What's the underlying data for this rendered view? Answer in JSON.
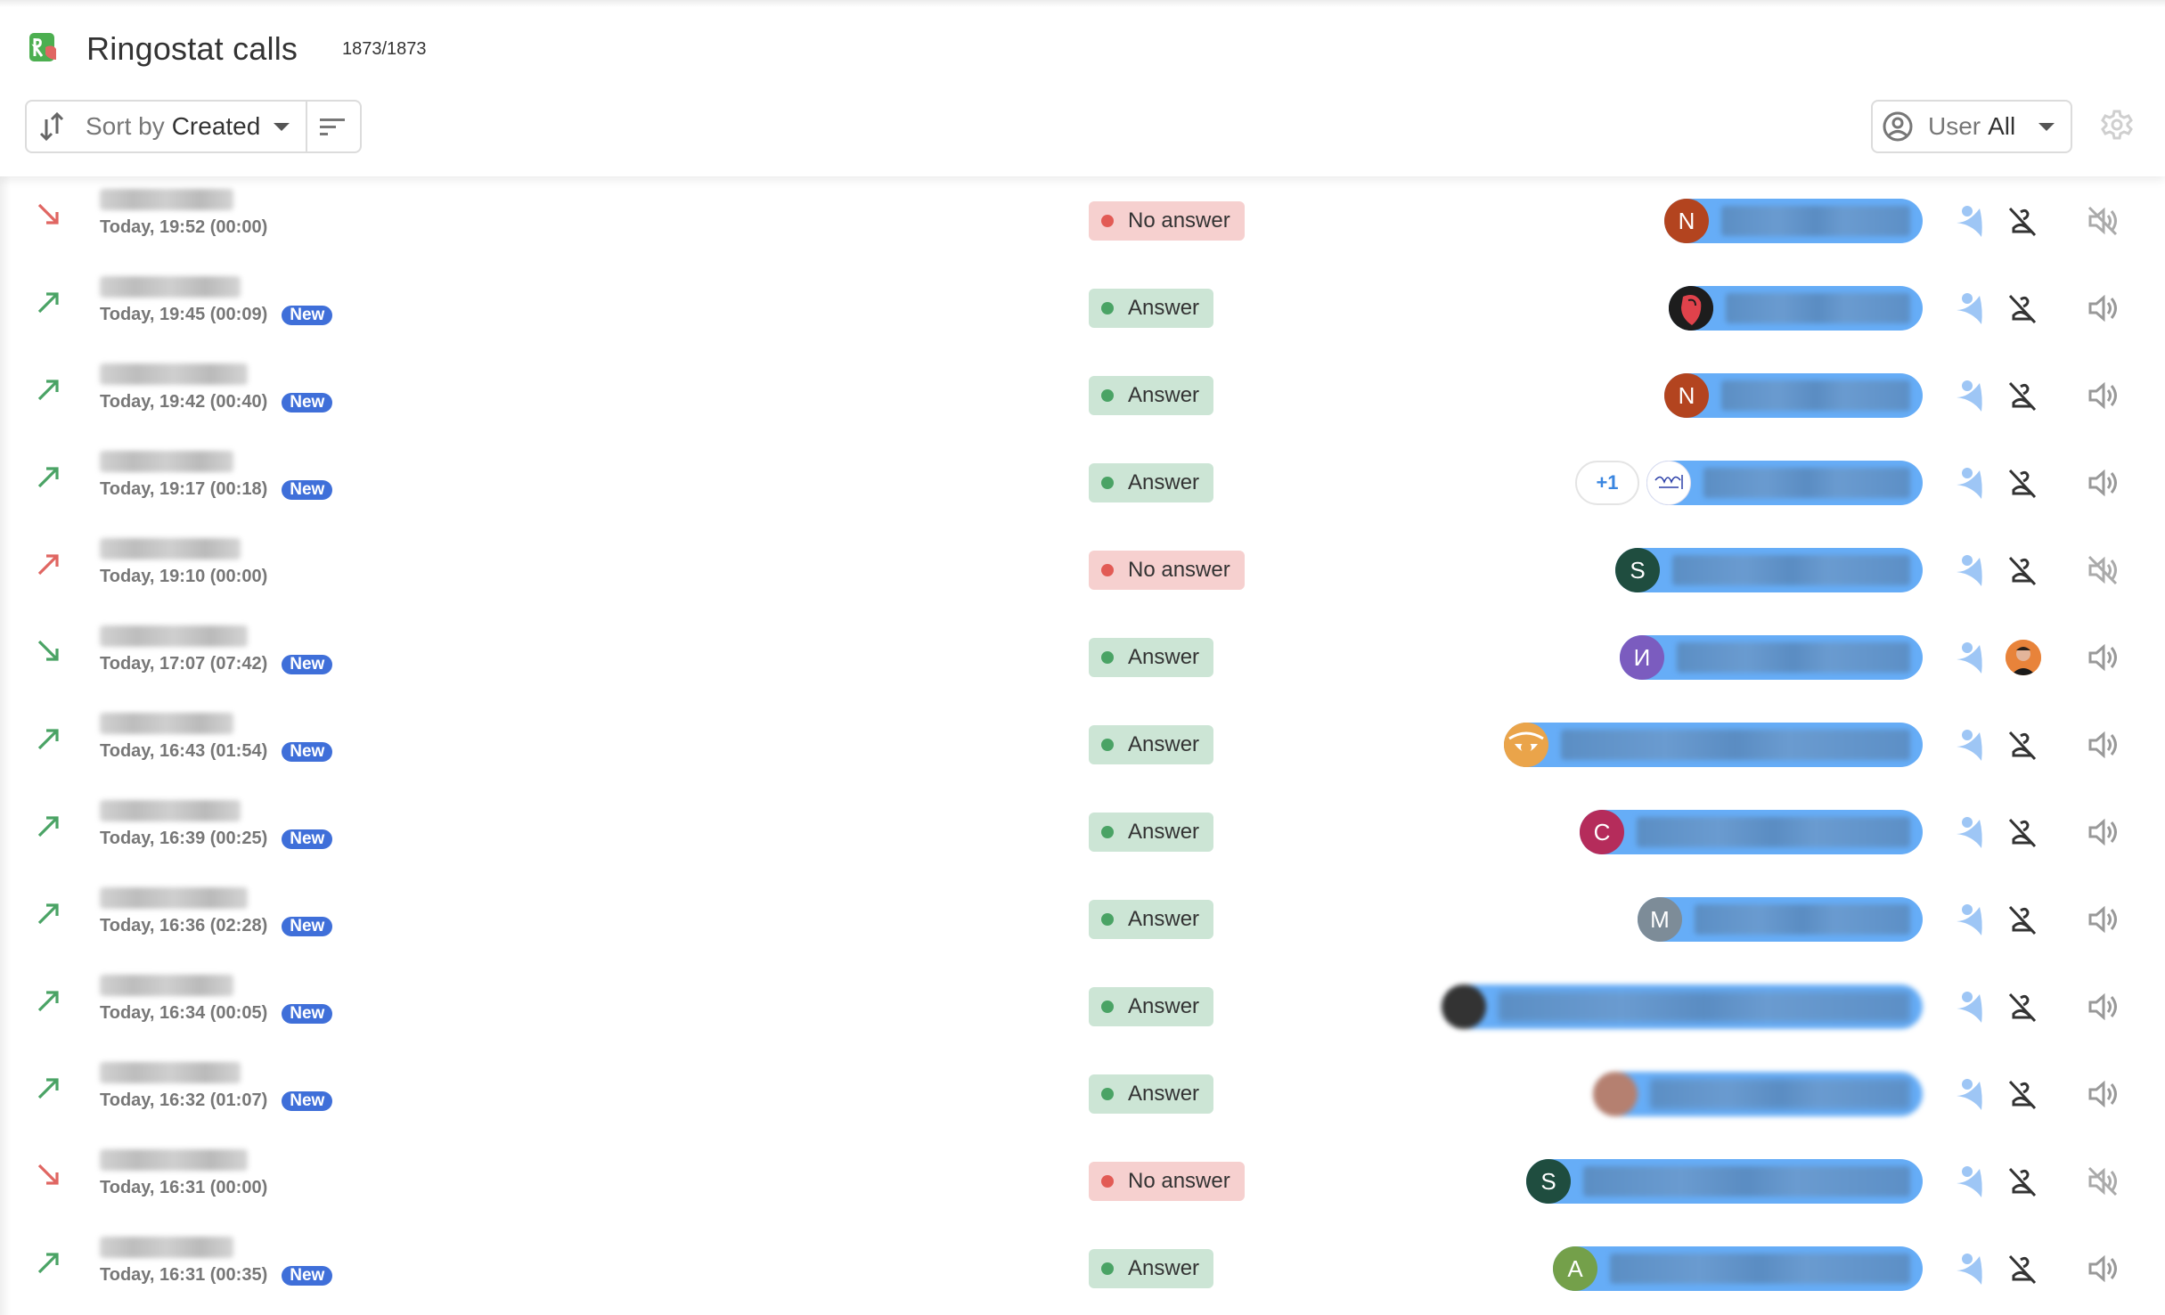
{
  "header": {
    "title": "Ringostat calls",
    "count": "1873/1873",
    "logo_icon": "ringostat-logo-icon"
  },
  "toolbar": {
    "sort_label": "Sort by",
    "sort_value": "Created",
    "sort_icon": "sort-arrows-icon",
    "filter_icon": "filter-lines-icon",
    "user_label": "User",
    "user_value": "All",
    "user_icon": "user-circle-icon",
    "settings_icon": "gear-icon"
  },
  "colors": {
    "missed": "#e06662",
    "answered": "#4aa365",
    "new_badge": "#3f6fd9",
    "user_pill": "#66adf7",
    "status_no_bg": "#f6d0cf",
    "status_yes_bg": "#cce5d5"
  },
  "calls": [
    {
      "direction": "incoming",
      "result": "missed",
      "phone": "[redacted]",
      "when": "Today, 19:52 (00:00)",
      "new": false,
      "new_label": "",
      "status": "No answer",
      "status_type": "no",
      "avatar": {
        "type": "letter",
        "letter": "N",
        "color": "#b3441f"
      },
      "user": "[redacted]",
      "extra_users": "",
      "contact": "no-contact",
      "sound": "muted"
    },
    {
      "direction": "outgoing",
      "result": "answered",
      "phone": "[redacted]",
      "when": "Today, 19:45 (00:09)",
      "new": true,
      "new_label": "New",
      "status": "Answer",
      "status_type": "yes",
      "avatar": {
        "type": "image-rose"
      },
      "user": "[redacted]",
      "extra_users": "",
      "contact": "no-contact",
      "sound": "on"
    },
    {
      "direction": "outgoing",
      "result": "answered",
      "phone": "[redacted]",
      "when": "Today, 19:42 (00:40)",
      "new": true,
      "new_label": "New",
      "status": "Answer",
      "status_type": "yes",
      "avatar": {
        "type": "letter",
        "letter": "N",
        "color": "#b3441f"
      },
      "user": "[redacted]",
      "extra_users": "",
      "contact": "no-contact",
      "sound": "on"
    },
    {
      "direction": "outgoing",
      "result": "answered",
      "phone": "[redacted]",
      "when": "Today, 19:17 (00:18)",
      "new": true,
      "new_label": "New",
      "status": "Answer",
      "status_type": "yes",
      "avatar": {
        "type": "image-sketch"
      },
      "user": "[redacted]",
      "extra_users": "+1",
      "contact": "no-contact",
      "sound": "on"
    },
    {
      "direction": "outgoing",
      "result": "missed",
      "phone": "[redacted]",
      "when": "Today, 19:10 (00:00)",
      "new": false,
      "new_label": "",
      "status": "No answer",
      "status_type": "no",
      "avatar": {
        "type": "letter",
        "letter": "S",
        "color": "#1f4d3f"
      },
      "user": "[redacted]",
      "extra_users": "",
      "contact": "no-contact",
      "sound": "muted"
    },
    {
      "direction": "incoming",
      "result": "answered",
      "phone": "[redacted]",
      "when": "Today, 17:07 (07:42)",
      "new": true,
      "new_label": "New",
      "status": "Answer",
      "status_type": "yes",
      "avatar": {
        "type": "letter",
        "letter": "И",
        "color": "#7b5cbf"
      },
      "user": "[redacted]",
      "extra_users": "",
      "contact": "contact-photo",
      "sound": "on"
    },
    {
      "direction": "outgoing",
      "result": "answered",
      "phone": "[redacted]",
      "when": "Today, 16:43 (01:54)",
      "new": true,
      "new_label": "New",
      "status": "Answer",
      "status_type": "yes",
      "avatar": {
        "type": "image-eye"
      },
      "user": "[redacted]",
      "extra_users": "",
      "contact": "no-contact",
      "sound": "on"
    },
    {
      "direction": "outgoing",
      "result": "answered",
      "phone": "[redacted]",
      "when": "Today, 16:39 (00:25)",
      "new": true,
      "new_label": "New",
      "status": "Answer",
      "status_type": "yes",
      "avatar": {
        "type": "letter",
        "letter": "C",
        "color": "#b52c5b"
      },
      "user": "[redacted]",
      "extra_users": "",
      "contact": "no-contact",
      "sound": "on"
    },
    {
      "direction": "outgoing",
      "result": "answered",
      "phone": "[redacted]",
      "when": "Today, 16:36 (02:28)",
      "new": true,
      "new_label": "New",
      "status": "Answer",
      "status_type": "yes",
      "avatar": {
        "type": "letter",
        "letter": "M",
        "color": "#7d8c98"
      },
      "user": "[redacted]",
      "extra_users": "",
      "contact": "no-contact",
      "sound": "on"
    },
    {
      "direction": "outgoing",
      "result": "answered",
      "phone": "[redacted]",
      "when": "Today, 16:34 (00:05)",
      "new": true,
      "new_label": "New",
      "status": "Answer",
      "status_type": "yes",
      "avatar": {
        "type": "image-dark"
      },
      "user": "[redacted]",
      "extra_users": "",
      "contact": "no-contact",
      "sound": "on"
    },
    {
      "direction": "outgoing",
      "result": "answered",
      "phone": "[redacted]",
      "when": "Today, 16:32 (01:07)",
      "new": true,
      "new_label": "New",
      "status": "Answer",
      "status_type": "yes",
      "avatar": {
        "type": "image-face"
      },
      "user": "[redacted]",
      "extra_users": "",
      "contact": "no-contact",
      "sound": "on"
    },
    {
      "direction": "incoming",
      "result": "missed",
      "phone": "[redacted]",
      "when": "Today, 16:31 (00:00)",
      "new": false,
      "new_label": "",
      "status": "No answer",
      "status_type": "no",
      "avatar": {
        "type": "letter",
        "letter": "S",
        "color": "#1f4d3f"
      },
      "user": "[redacted]",
      "extra_users": "",
      "contact": "no-contact",
      "sound": "muted"
    },
    {
      "direction": "outgoing",
      "result": "answered",
      "phone": "[redacted]",
      "when": "Today, 16:31 (00:35)",
      "new": true,
      "new_label": "New",
      "status": "Answer",
      "status_type": "yes",
      "avatar": {
        "type": "letter",
        "letter": "A",
        "color": "#74a04a"
      },
      "user": "[redacted]",
      "extra_users": "",
      "contact": "no-contact",
      "sound": "on"
    }
  ]
}
